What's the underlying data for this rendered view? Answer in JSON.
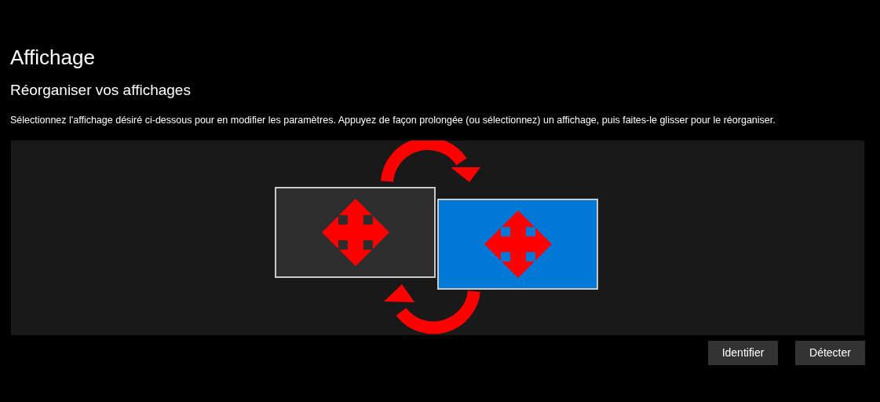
{
  "page": {
    "title": "Affichage"
  },
  "section": {
    "title": "Réorganiser vos affichages",
    "description": "Sélectionnez l'affichage désiré ci-dessous pour en modifier les paramètres. Appuyez de façon prolongée (ou sélectionnez) un affichage, puis faites-le glisser pour le réorganiser."
  },
  "monitors": [
    {
      "selected": false
    },
    {
      "selected": true
    }
  ],
  "buttons": [
    "Identifier",
    "Détecter"
  ]
}
